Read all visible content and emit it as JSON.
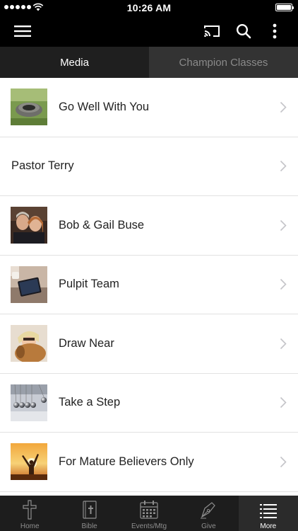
{
  "status_bar": {
    "time": "10:26 AM"
  },
  "app_bar": {
    "icons": [
      "menu-icon",
      "cast-icon",
      "search-icon",
      "more-vertical-icon"
    ]
  },
  "tabs": [
    {
      "label": "Media",
      "active": true
    },
    {
      "label": "Champion Classes",
      "active": false
    }
  ],
  "list": {
    "items": [
      {
        "title": "Go Well With You",
        "thumbnail": "stone-well"
      },
      {
        "title": "Pastor Terry",
        "thumbnail": null
      },
      {
        "title": "Bob & Gail Buse",
        "thumbnail": "couple-photo"
      },
      {
        "title": "Pulpit Team",
        "thumbnail": "tablet-desk"
      },
      {
        "title": "Draw Near",
        "thumbnail": "woman-dog"
      },
      {
        "title": "Take a Step",
        "thumbnail": "newtons-cradle"
      },
      {
        "title": "For Mature Believers Only",
        "thumbnail": "sunset-arms"
      }
    ]
  },
  "bottom_nav": {
    "items": [
      {
        "label": "Home",
        "icon": "cross-icon",
        "active": false
      },
      {
        "label": "Bible",
        "icon": "bible-icon",
        "active": false
      },
      {
        "label": "Events/Mtg",
        "icon": "calendar-icon",
        "active": false
      },
      {
        "label": "Give",
        "icon": "pen-nib-icon",
        "active": false
      },
      {
        "label": "More",
        "icon": "list-icon",
        "active": true
      }
    ]
  }
}
